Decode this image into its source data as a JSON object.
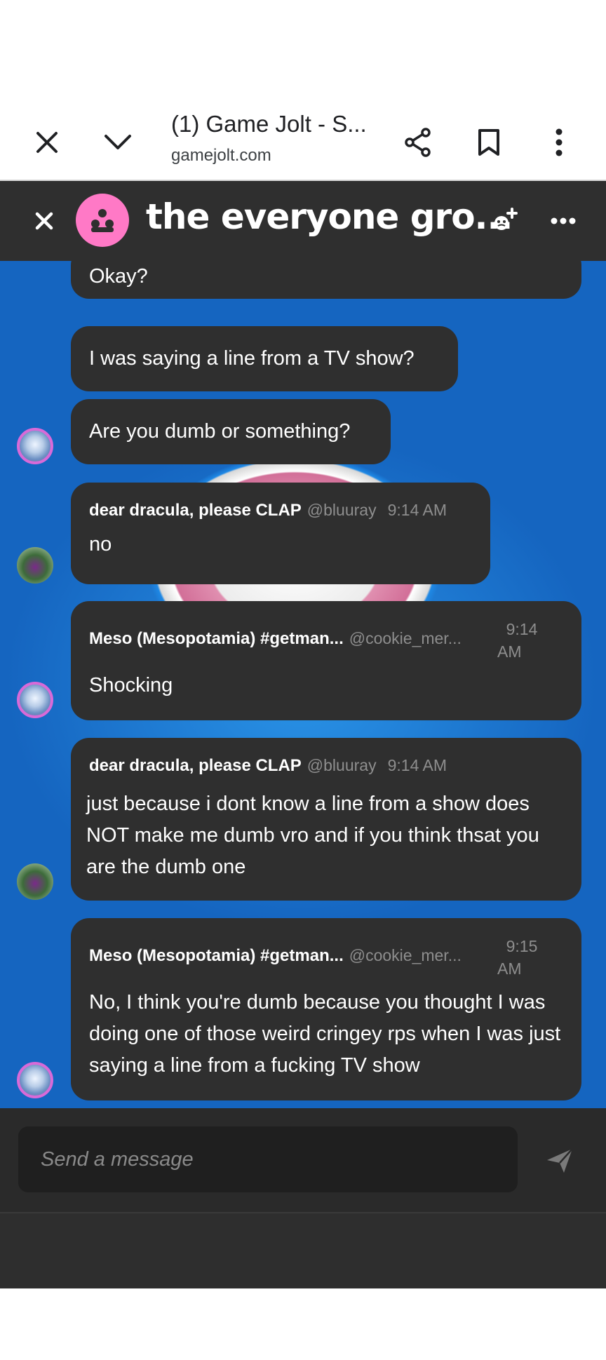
{
  "browser": {
    "title": "(1) Game Jolt - S...",
    "url": "gamejolt.com",
    "icons": [
      "close-icon",
      "chevron-down-icon",
      "share-icon",
      "bookmark-icon",
      "more-vert-icon"
    ]
  },
  "chat": {
    "title": "the everyone gro...",
    "header_icons": [
      "close-icon",
      "group-icon",
      "add-member-icon",
      "more-horiz-icon"
    ],
    "messages": [
      {
        "text": "Okay?"
      },
      {
        "text": "I was saying a line from a TV show?"
      },
      {
        "text": "Are you dumb or something?"
      },
      {
        "name": "dear dracula, please CLAP",
        "handle": "@bluuray",
        "time": "9:14 AM",
        "text": "no"
      },
      {
        "name": "Meso (Mesopotamia) #getman...",
        "handle": "@cookie_mer...",
        "time_1": "9:14",
        "time_2": "AM",
        "text": "Shocking"
      },
      {
        "name": "dear dracula, please CLAP",
        "handle": "@bluuray",
        "time": "9:14 AM",
        "text": "just because i dont know a line from a show does NOT make me dumb vro and if you think thsat you are the dumb one"
      },
      {
        "name": "Meso (Mesopotamia) #getman...",
        "handle": "@cookie_mer...",
        "time_1": "9:15",
        "time_2": "AM",
        "text": "No, I think you're dumb because you thought I was doing one of those weird cringey rps when I was just saying a line from a fucking TV show"
      }
    ]
  },
  "composer": {
    "placeholder": "Send a message",
    "send_icon": "send-icon"
  }
}
